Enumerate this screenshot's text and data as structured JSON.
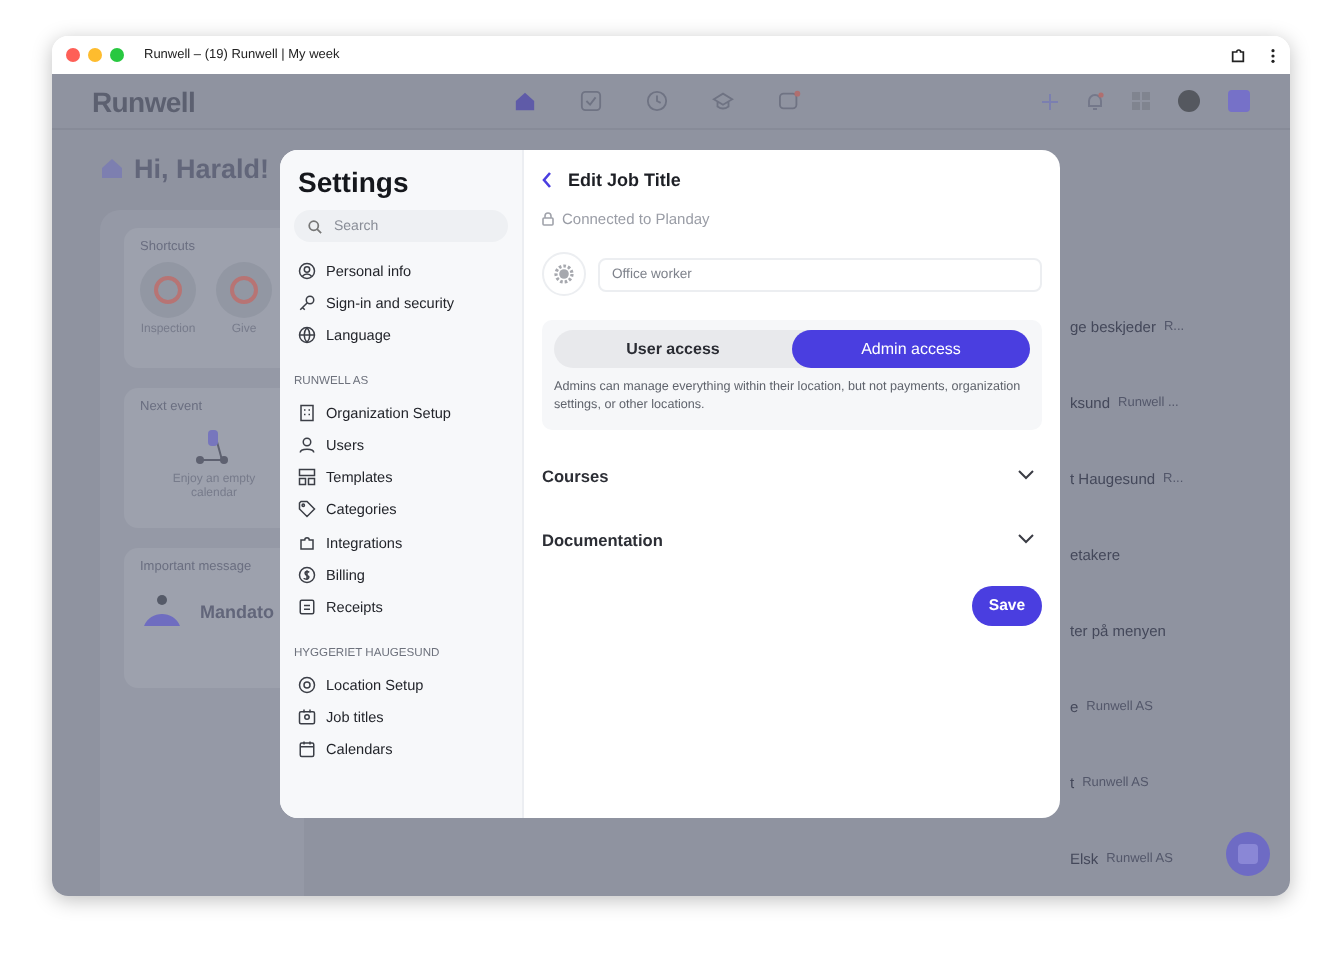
{
  "window": {
    "title": "Runwell – (19) Runwell | My week"
  },
  "app": {
    "logo": "Runwell",
    "greeting": "Hi, Harald!",
    "cards": [
      {
        "kind": "shortcuts",
        "title": "Shortcuts",
        "items": [
          "Inspection",
          "Give"
        ]
      },
      {
        "kind": "event",
        "title": "Next event",
        "text": "Enjoy an empty calendar"
      },
      {
        "kind": "message",
        "title": "Important message",
        "text": "Mandato"
      }
    ],
    "list": [
      {
        "title": "ge beskjeder",
        "sub": "R..."
      },
      {
        "title": "ksund",
        "sub": "Runwell ..."
      },
      {
        "title": "t Haugesund",
        "sub": "R..."
      },
      {
        "title": "etakere"
      },
      {
        "title": "ter på menyen"
      },
      {
        "title": "e",
        "sub": "Runwell AS"
      },
      {
        "title": "t",
        "sub": "Runwell AS"
      },
      {
        "title": "Elsk",
        "sub": "Runwell AS"
      }
    ]
  },
  "settings": {
    "title": "Settings",
    "search": {
      "placeholder": "Search"
    },
    "groups": [
      {
        "items": [
          "Personal info",
          "Sign-in and security",
          "Language"
        ]
      },
      {
        "heading": "RUNWELL AS",
        "items": [
          "Organization Setup",
          "Users",
          "Templates",
          "Categories",
          "Integrations",
          "Billing",
          "Receipts"
        ]
      },
      {
        "heading": "HYGGERIET HAUGESUND",
        "items": [
          "Location Setup",
          "Job titles",
          "Calendars"
        ]
      }
    ]
  },
  "editor": {
    "title": "Edit Job Title",
    "note": "Connected to Planday",
    "field": {
      "placeholder": "Office worker"
    },
    "access": [
      {
        "label": "User access",
        "selected": false
      },
      {
        "label": "Admin access",
        "selected": true
      }
    ],
    "description": "Admins can manage everything within their location, but not payments, organization settings, or other locations.",
    "sections": [
      {
        "label": "Courses",
        "expanded": false
      },
      {
        "label": "Documentation",
        "expanded": false
      }
    ],
    "save": "Save"
  }
}
